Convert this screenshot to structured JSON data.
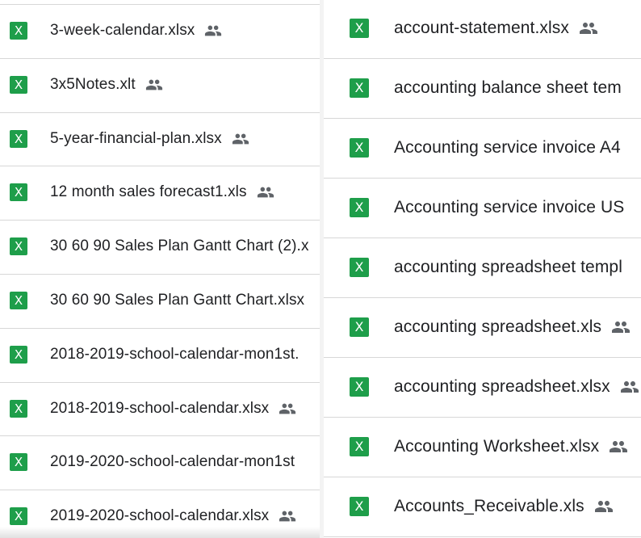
{
  "left_list": {
    "files": [
      {
        "name": "3-week-calendar.xlsx",
        "type_icon": "excel-icon",
        "type_label": "X",
        "shared": true
      },
      {
        "name": "3x5Notes.xlt",
        "type_icon": "excel-icon",
        "type_label": "X",
        "shared": true
      },
      {
        "name": "5-year-financial-plan.xlsx",
        "type_icon": "excel-icon",
        "type_label": "X",
        "shared": true
      },
      {
        "name": "12 month sales forecast1.xls",
        "type_icon": "excel-icon",
        "type_label": "X",
        "shared": true
      },
      {
        "name": "30 60 90 Sales Plan Gantt Chart (2).x",
        "type_icon": "excel-icon",
        "type_label": "X",
        "shared": false
      },
      {
        "name": "30 60 90 Sales Plan Gantt Chart.xlsx",
        "type_icon": "excel-icon",
        "type_label": "X",
        "shared": false
      },
      {
        "name": "2018-2019-school-calendar-mon1st.",
        "type_icon": "excel-icon",
        "type_label": "X",
        "shared": false
      },
      {
        "name": "2018-2019-school-calendar.xlsx",
        "type_icon": "excel-icon",
        "type_label": "X",
        "shared": true
      },
      {
        "name": "2019-2020-school-calendar-mon1st",
        "type_icon": "excel-icon",
        "type_label": "X",
        "shared": false
      },
      {
        "name": "2019-2020-school-calendar.xlsx",
        "type_icon": "excel-icon",
        "type_label": "X",
        "shared": true
      }
    ]
  },
  "right_list": {
    "files": [
      {
        "name": "account-statement.xlsx",
        "type_icon": "excel-icon",
        "type_label": "X",
        "shared": true
      },
      {
        "name": "accounting balance sheet tem",
        "type_icon": "excel-icon",
        "type_label": "X",
        "shared": false
      },
      {
        "name": "Accounting service  invoice A4",
        "type_icon": "excel-icon",
        "type_label": "X",
        "shared": false
      },
      {
        "name": "Accounting service  invoice US",
        "type_icon": "excel-icon",
        "type_label": "X",
        "shared": false
      },
      {
        "name": "accounting spreadsheet templ",
        "type_icon": "excel-icon",
        "type_label": "X",
        "shared": false
      },
      {
        "name": "accounting spreadsheet.xls",
        "type_icon": "excel-icon",
        "type_label": "X",
        "shared": true
      },
      {
        "name": "accounting spreadsheet.xlsx",
        "type_icon": "excel-icon",
        "type_label": "X",
        "shared": true
      },
      {
        "name": "Accounting Worksheet.xlsx",
        "type_icon": "excel-icon",
        "type_label": "X",
        "shared": true
      },
      {
        "name": "Accounts_Receivable.xls",
        "type_icon": "excel-icon",
        "type_label": "X",
        "shared": true
      }
    ]
  },
  "colors": {
    "excel_green": "#1e9e4a",
    "text": "#202124",
    "icon_gray": "#5f6368",
    "divider": "#d7d7d7"
  }
}
